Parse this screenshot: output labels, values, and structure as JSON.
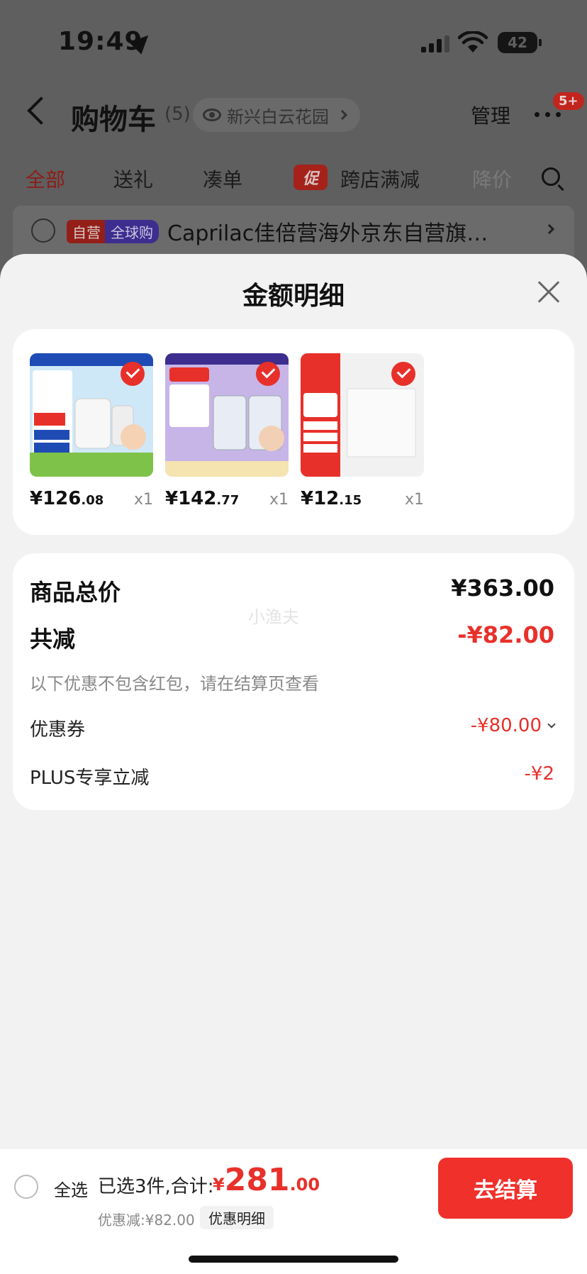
{
  "status_bar": {
    "time": "19:49",
    "battery": "42"
  },
  "header": {
    "title": "购物车",
    "count": "(5)",
    "address": "新兴白云花园",
    "manage": "管理",
    "badge": "5+"
  },
  "tabs": {
    "all": "全部",
    "gift": "送礼",
    "bundle": "凑单",
    "promo_tag": "促",
    "cross_store": "跨店满减",
    "price_drop": "降价"
  },
  "shop": {
    "tag_self": "自营",
    "tag_global": "全球购",
    "name": "Caprilac佳倍营海外京东自营旗…"
  },
  "sheet": {
    "title": "金额明细",
    "products": [
      {
        "price_int": "¥126",
        "price_dec": ".08",
        "qty": "x1"
      },
      {
        "price_int": "¥142",
        "price_dec": ".77",
        "qty": "x1"
      },
      {
        "price_int": "¥12",
        "price_dec": ".15",
        "qty": "x1"
      }
    ],
    "watermark": "小渔夫",
    "summary": {
      "total_label": "商品总价",
      "total_value": "¥363.00",
      "reduce_label": "共减",
      "reduce_value": "-¥82.00",
      "note": "以下优惠不包含红包，请在结算页查看",
      "coupon_label": "优惠券",
      "coupon_value": "-¥80.00",
      "plus_label": "PLUS专享立减",
      "plus_value": "-¥2"
    }
  },
  "bottom_bar": {
    "select_all": "全选",
    "selected_text": "已选3件,合计:",
    "currency": "¥",
    "total_int": "281",
    "total_dec": ".00",
    "discount_text": "优惠减:¥82.00",
    "detail_label": "优惠明细",
    "checkout_label": "去结算"
  }
}
